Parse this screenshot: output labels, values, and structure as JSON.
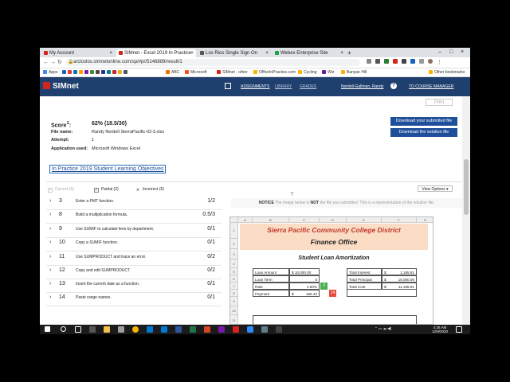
{
  "browser": {
    "tabs": [
      {
        "label": "My Account",
        "color": "#d6231e"
      },
      {
        "label": "SIMnet - Excel 2019 In Practice",
        "color": "#d6231e"
      },
      {
        "label": "Los Rios Single Sign On",
        "color": "#555555"
      },
      {
        "label": "Webex Enterprise Site",
        "color": "#1ba34a"
      }
    ],
    "url": "arcloslos.simnetonline.com/sp/#pr/5146889/result/1",
    "bookmarks": [
      "Apps",
      "ABC",
      "Microsoft",
      "SIMnet - other",
      "OfficeInPractice.com",
      "Cycling",
      "Wiz",
      "Banyan Hill",
      "Other bookmarks"
    ]
  },
  "simnet": {
    "logo": "SIMnet",
    "nav": {
      "assignments": "ASSIGNMENTS",
      "library": "LIBRARY",
      "grades": "GRADES",
      "user": "Nordell-Gallman, Randy",
      "course_manager": "TO COURSE MANAGER"
    }
  },
  "result": {
    "print_label": "Print",
    "score_label": "Score",
    "score_superscript": "1",
    "score_value": "62% (18.5/30)",
    "file_name_label": "File name:",
    "file_name_value": "Randy Nordell SierraPacific-02-3.xlsx",
    "attempt_label": "Attempt:",
    "attempt_value": "1",
    "app_label": "Application used:",
    "app_value": "Microsoft Windows Excel",
    "download_submitted": "Download your submitted file",
    "download_solution": "Download the solution file",
    "objectives_title": "In Practice 2019 Student Learning Objectives"
  },
  "filters": {
    "correct": "Correct (5)",
    "partial": "Partial (2)",
    "incorrect": "Incorrect (6)",
    "view_options": "View Options"
  },
  "tasks": [
    {
      "num": "3",
      "text": "Enter a PMT function.",
      "points": "1/2"
    },
    {
      "num": "8",
      "text": "Build a multiplication formula.",
      "points": "0.5/3"
    },
    {
      "num": "9",
      "text": "Use SUMIF to calculate fees by department.",
      "points": "0/1"
    },
    {
      "num": "10",
      "text": "Copy a SUMIF function.",
      "points": "0/1"
    },
    {
      "num": "11",
      "text": "Use SUMPRODUCT and trace an error.",
      "points": "0/2"
    },
    {
      "num": "12",
      "text": "Copy and edit SUMPRODUCT.",
      "points": "0/2"
    },
    {
      "num": "13",
      "text": "Insert the current date as a function.",
      "points": "0/1"
    },
    {
      "num": "14",
      "text": "Paste range names.",
      "points": "0/1"
    }
  ],
  "notice": {
    "prefix": "NOTICE",
    "text_a": " The image below is ",
    "not": "NOT",
    "text_b": " the file you submitted. This is a representation of the solution file."
  },
  "spreadsheet": {
    "columns": [
      "A",
      "B",
      "C",
      "D",
      "E",
      "F",
      "G"
    ],
    "rows": [
      "1",
      "2",
      "3",
      "4",
      "5",
      "6",
      "7",
      "8",
      "9",
      "10",
      "11"
    ],
    "title1": "Sierra Pacific Community College District",
    "title2": "Finance Office",
    "subtitle": "Student Loan Amortization",
    "left": {
      "loan_amount_label": "Loan Amount",
      "loan_amount_cur": "$",
      "loan_amount_val": "10,000.00",
      "loan_term_label": "Loan Term",
      "loan_term_val": "5",
      "rate_label": "Rate",
      "rate_val": "4.50%",
      "payment_label": "Payment",
      "payment_cur": "$",
      "payment_val": "186.43"
    },
    "right": {
      "interest_label": "Total Interest",
      "interest_cur": "$",
      "interest_val": "1,185.81",
      "principal_label": "Total Principal",
      "principal_cur": "$",
      "principal_val": "10,000.00",
      "cost_label": "Total Cost",
      "cost_cur": "$",
      "cost_val": "11,185.81"
    },
    "badges": {
      "green": "3",
      "red": "14"
    }
  },
  "taskbar": {
    "time": "4:26 AM",
    "date": "12/9/2020"
  },
  "colors": {
    "header_bg": "#1f3f6e",
    "button_bg": "#1f4e9a",
    "brand_red": "#d6231e",
    "title_red": "#c0392b",
    "banner_bg": "#fbdcc4"
  }
}
